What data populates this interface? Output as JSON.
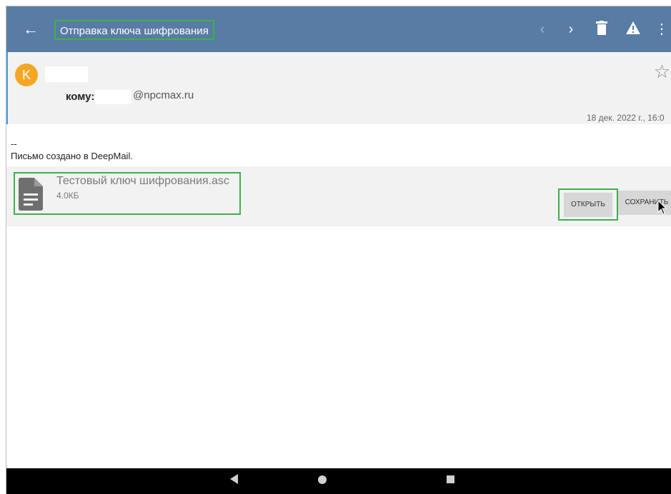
{
  "toolbar": {
    "title": "Отправка ключа шифрования",
    "back_icon": "arrow-left-icon",
    "prev_icon": "chevron-left-icon",
    "next_icon": "chevron-right-icon",
    "delete_icon": "trash-icon",
    "spam_icon": "warning-icon",
    "menu_icon": "more-vert-icon",
    "bar_color": "#587ca4"
  },
  "message": {
    "avatar_letter": "K",
    "avatar_color": "#f5a623",
    "to_label": "кому:",
    "to_address": "@npcmax.ru",
    "date": "18 дек. 2022 г., 16:0",
    "star_icon": "star-outline-icon"
  },
  "body": {
    "signature_dash": "--",
    "signature_text": "Письмо создано в DeepMail."
  },
  "attachment": {
    "file_name": "Тестовый ключ шифрования.asc",
    "file_size": "4.0КБ",
    "file_icon": "document-icon",
    "open_label": "ОТКРЫТЬ",
    "save_label": "СОХРАНИТЬ"
  },
  "system_nav": {
    "back_icon": "nav-back-icon",
    "home_icon": "nav-home-icon",
    "recents_icon": "nav-recents-icon"
  }
}
